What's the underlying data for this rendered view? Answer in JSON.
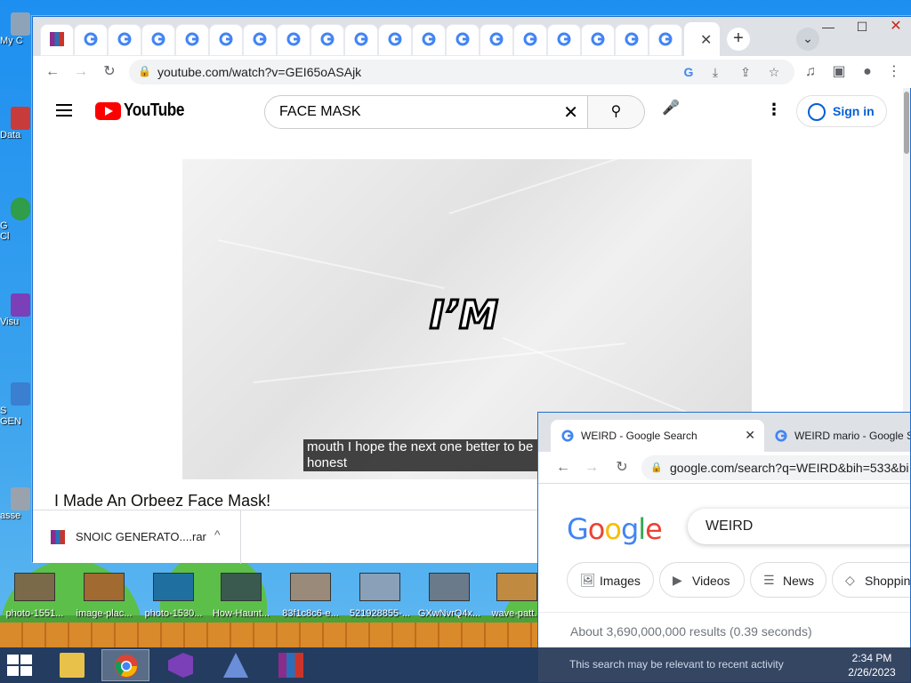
{
  "desktop": {
    "icons": [
      {
        "label": "My C",
        "color": "#8fa3b8"
      },
      {
        "label": "Data",
        "color": "#c83b3b"
      },
      {
        "label": "G",
        "color": "#2f9d4a"
      },
      {
        "label": "Cl",
        "color": "#2f9d4a"
      },
      {
        "label": "Visu",
        "color": "#7b3fb8"
      },
      {
        "label": "S",
        "color": "#3a7fd0"
      },
      {
        "label": "GEN",
        "color": "#3a7fd0"
      },
      {
        "label": "asse",
        "color": "#9aa3ad"
      }
    ],
    "thumbnails": [
      {
        "label": "photo-1551...",
        "color": "#7a6a4a"
      },
      {
        "label": "image-plac...",
        "color": "#a06a30"
      },
      {
        "label": "photo-1530...",
        "color": "#1f6fa0"
      },
      {
        "label": "How-Haunt...",
        "color": "#3a5a50"
      },
      {
        "label": "83f1c8c6-e...",
        "color": "#9a8a7a"
      },
      {
        "label": "521928855-...",
        "color": "#8aa0b8"
      },
      {
        "label": "GXwNvrQ4x...",
        "color": "#6a7a8a"
      },
      {
        "label": "wave-patt...",
        "color": "#c08a40"
      }
    ]
  },
  "chrome_main": {
    "window_controls": {
      "minimize": "—",
      "maximize": "☐",
      "close": "✕"
    },
    "tab_close": "✕",
    "new_tab": "+",
    "tab_search": "⌄",
    "url": "youtube.com/watch?v=GEI65oASAjk",
    "toolbar_icons": [
      "back-icon",
      "forward-icon",
      "reload-icon"
    ],
    "youtube": {
      "logo_text": "YouTube",
      "search_value": "FACE MASK",
      "clear": "✕",
      "search_icon": "⚲",
      "mic_icon": "🎤",
      "more_icon": "⋮",
      "signin_label": "Sign in",
      "video_word": "I’M",
      "caption": "mouth I hope the next one better to be honest",
      "title": "I Made An Orbeez Face Mask!"
    },
    "download": {
      "file_name": "SNOIC GENERATO....rar",
      "chevron": "^"
    }
  },
  "chrome_google": {
    "tabs": [
      {
        "title": "WEIRD - Google Search",
        "close": "✕"
      },
      {
        "title": "WEIRD mario - Google S"
      }
    ],
    "url": "google.com/search?q=WEIRD&bih=533&bi",
    "logo": "Google",
    "search_value": "WEIRD",
    "chips": [
      {
        "icon": "🖼",
        "label": "Images"
      },
      {
        "icon": "▶",
        "label": "Videos"
      },
      {
        "icon": "☰",
        "label": "News"
      },
      {
        "icon": "◇",
        "label": "Shopping"
      }
    ],
    "stats": "About 3,690,000,000 results (0.39 seconds)",
    "notice": "This search may be relevant to recent activity"
  },
  "taskbar": {
    "time": "2:34 PM",
    "date": "2/26/2023",
    "apps": [
      "file-explorer-icon",
      "chrome-icon",
      "visual-studio-icon",
      "app-icon",
      "winrar-icon"
    ]
  },
  "colors": {
    "youtube_red": "#ff0000",
    "link_blue": "#065fd4",
    "chrome_tabstrip": "#dee1e6",
    "taskbar": "#243656"
  }
}
